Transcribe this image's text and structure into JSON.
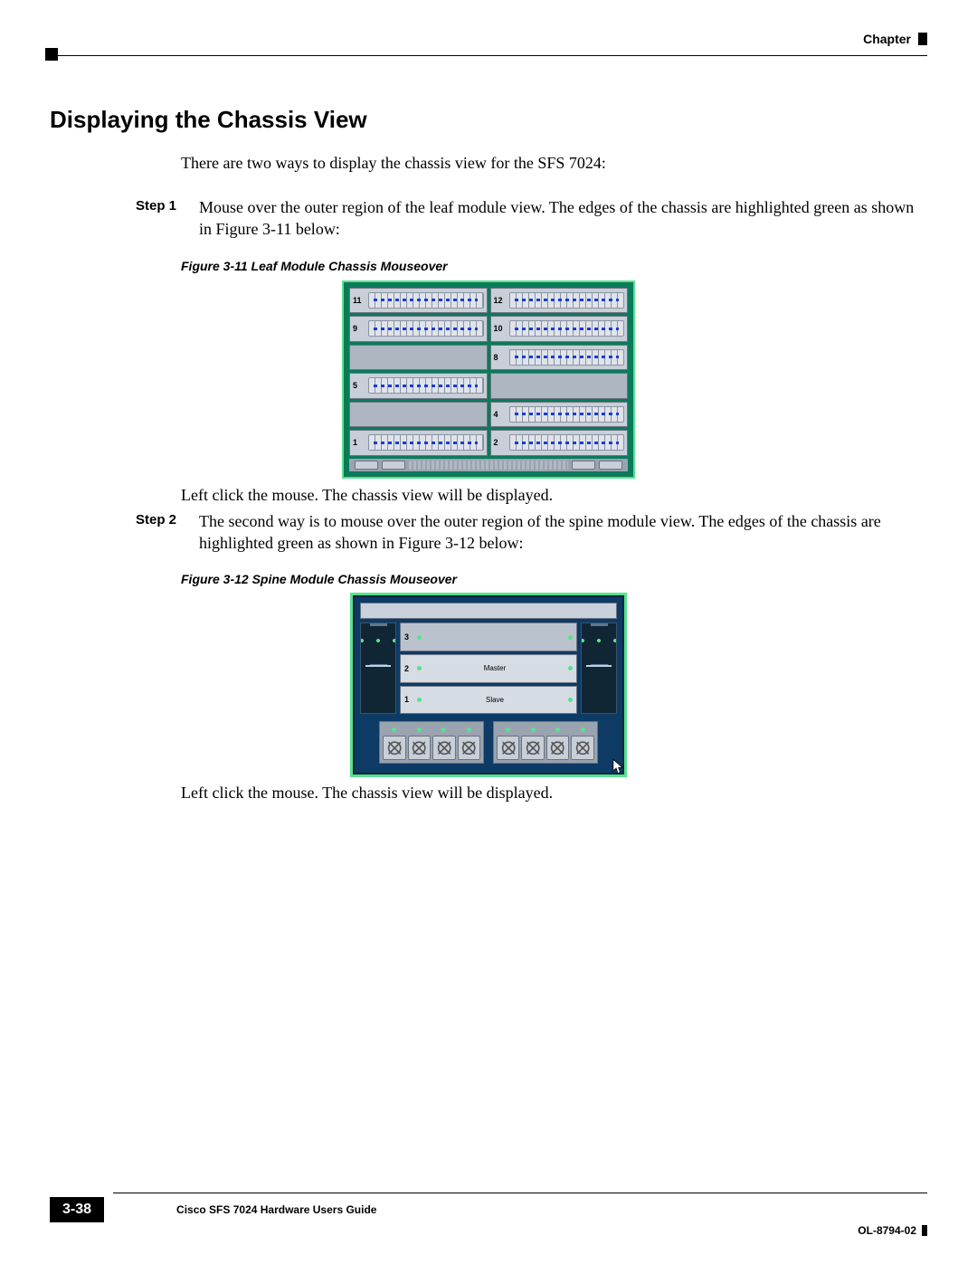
{
  "header": {
    "chapter_label": "Chapter"
  },
  "section": {
    "title": "Displaying the Chassis View"
  },
  "intro": "There are two ways to display the chassis view for the SFS 7024:",
  "steps": {
    "s1": {
      "label": "Step 1",
      "text": "Mouse over the outer region of the leaf module view. The edges of the chassis are highlighted green as shown in Figure 3-11 below:"
    },
    "s2": {
      "label": "Step 2",
      "text": "The second way is to mouse over the outer region of the spine module view. The edges of the chassis are highlighted green as shown in Figure 3-12 below:"
    }
  },
  "fig1": {
    "caption": "Figure 3-11    Leaf Module Chassis Mouseover",
    "slots_left": [
      "11",
      "9",
      "",
      "5",
      "",
      "1"
    ],
    "slots_right": [
      "12",
      "10",
      "8",
      "",
      "4",
      "2"
    ],
    "after": "Left click the mouse. The chassis view will be displayed."
  },
  "fig2": {
    "caption": "Figure 3-12    Spine Module Chassis Mouseover",
    "controllers": [
      {
        "num": "3",
        "label": ""
      },
      {
        "num": "2",
        "label": "Master"
      },
      {
        "num": "1",
        "label": "Slave"
      }
    ],
    "after": "Left click the mouse. The chassis view will be displayed."
  },
  "footer": {
    "guide": "Cisco SFS 7024 Hardware Users Guide",
    "page": "3-38",
    "docid": "OL-8794-02"
  }
}
